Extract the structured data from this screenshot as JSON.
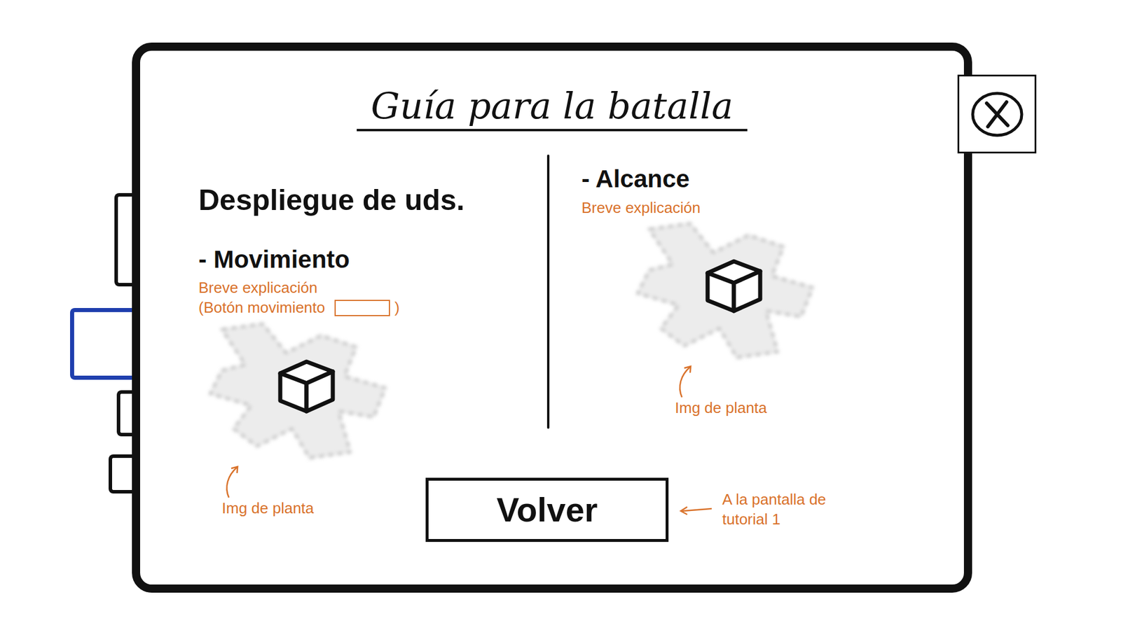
{
  "window": {
    "title": "Guía para la batalla"
  },
  "side_tabs": [
    {
      "selected": false
    },
    {
      "selected": true
    },
    {
      "selected": false
    },
    {
      "selected": false
    }
  ],
  "left": {
    "heading": "Despliegue de uds.",
    "subsection": {
      "title": "- Movimiento",
      "description": "Breve explicación",
      "button_note": "(Botón movimiento",
      "button_note_end": ")",
      "image_caption": "Img de planta"
    }
  },
  "right": {
    "subsection": {
      "title": "- Alcance",
      "description": "Breve explicación",
      "image_caption": "Img de planta"
    }
  },
  "footer": {
    "button": "Volver",
    "note": "A la pantalla de tutorial 1"
  }
}
